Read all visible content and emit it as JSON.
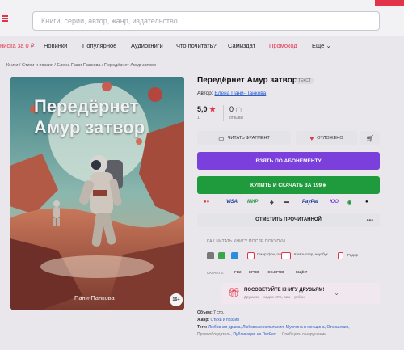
{
  "header": {
    "search_placeholder": "Книги, серии, автор, жанр, издательство",
    "brand_color": "#e2334a"
  },
  "nav": {
    "items": [
      "Новинки",
      "Популярное",
      "Аудиокниги",
      "Что почитать?",
      "Самиздат",
      "Промокод",
      "Ещё"
    ],
    "promo_left": "ниска за 0 ₽"
  },
  "breadcrumbs": {
    "text": "Книги / Стихи и поэзия / Елена Пани-Панкова / Передёрнет Амур затвор"
  },
  "book": {
    "cover_title": "Передёрнет Амур затвор",
    "cover_author": "Пани-Панкова",
    "age_rating": "16+",
    "title": "Передёрнет Амур затвор",
    "type_badge": "ТЕКСТ",
    "author_label": "Автор:",
    "author_name": "Елена Пани-Панкова",
    "rating": "5,0",
    "rating_count": "1",
    "reviews_count": "0",
    "reviews_label": "отзывы"
  },
  "actions": {
    "read_fragment": "ЧИТАТЬ ФРАГМЕНТ",
    "postponed": "ОТЛОЖЕНО",
    "subscribe": "ВЗЯТЬ ПО АБОНЕМЕНТУ",
    "buy": "КУПИТЬ И СКАЧАТЬ ЗА 199 ₽",
    "mark_read": "ОТМЕТИТЬ ПРОЧИТАННОЙ"
  },
  "payments": [
    "VISA",
    "МИР",
    "PayPal",
    "ЮMoney"
  ],
  "reading": {
    "how_to_read": "КАК ЧИТАТЬ КНИГУ ПОСЛЕ ПОКУПКИ",
    "devices": [
      "Смартфон, планшет",
      "Компьютер, ноутбук",
      "Ридер"
    ],
    "download_label": "СКАЧАТЬ:",
    "formats": [
      "FB2",
      "EPUB",
      "IOS.EPUB",
      "ЕЩЁ 7"
    ]
  },
  "advise": {
    "title": "ПОСОВЕТУЙТЕ КНИГУ ДРУЗЬЯМ!",
    "subtitle": "Друзьям – скидка 10%, вам – рубли"
  },
  "meta": {
    "volume_label": "Объем:",
    "volume_value": "7 стр.",
    "genre_label": "Жанр:",
    "genre_value": "Стихи и поэзия",
    "tags_label": "Теги:",
    "tags_value": "Любовная драма, Любовные испытания, Мужчина и женщина, Отношения,",
    "tags_value2": "Публикация на ЛитРес",
    "tags_value3": "Правообладатель",
    "tags_more": "Сообщить о нарушении"
  },
  "colors": {
    "subscribe_bg": "#7b3fdb",
    "buy_bg": "#1f9a3d",
    "link": "#2b5ec8"
  }
}
